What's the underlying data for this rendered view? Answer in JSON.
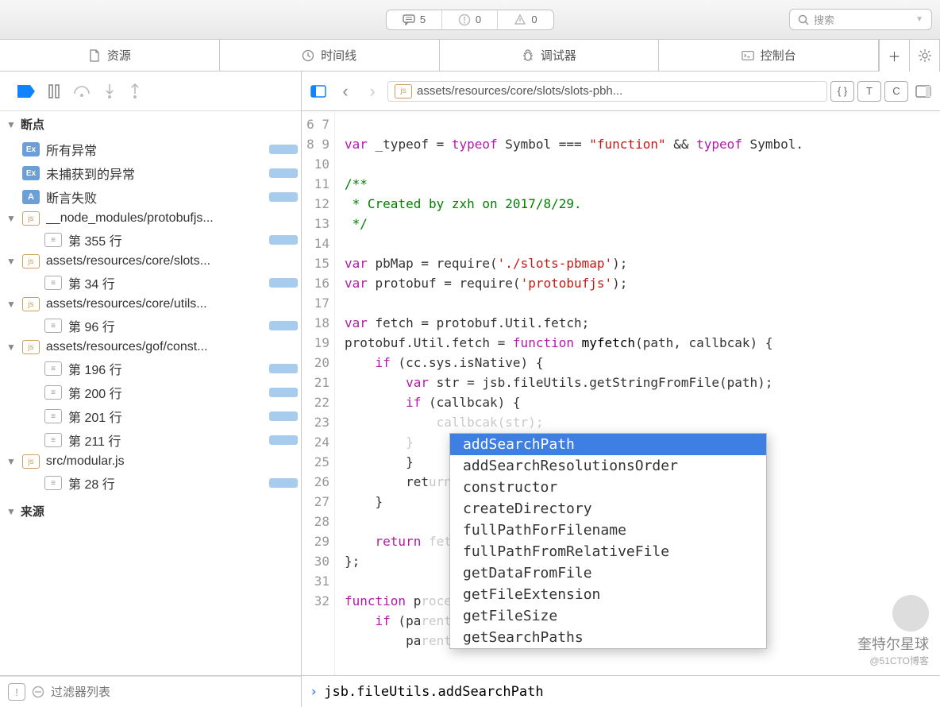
{
  "titlebar": {
    "messages_count": "5",
    "warnings_count": "0",
    "errors_count": "0",
    "search_placeholder": "搜索"
  },
  "panel_tabs": {
    "resources": "资源",
    "timeline": "时间线",
    "debugger": "调试器",
    "console": "控制台"
  },
  "sidebar": {
    "header_breakpoints": "断点",
    "items": [
      {
        "type": "ex",
        "label": "所有异常"
      },
      {
        "type": "ex",
        "label": "未捕获到的异常"
      },
      {
        "type": "a",
        "label": "断言失败"
      }
    ],
    "groups": [
      {
        "badge": "js",
        "label": "__node_modules/protobufjs...",
        "lines": [
          "第 355 行"
        ]
      },
      {
        "badge": "js",
        "label": "assets/resources/core/slots...",
        "lines": [
          "第 34 行"
        ]
      },
      {
        "badge": "js",
        "label": "assets/resources/core/utils...",
        "lines": [
          "第 96 行"
        ]
      },
      {
        "badge": "js",
        "label": "assets/resources/gof/const...",
        "lines": [
          "第 196 行",
          "第 200 行",
          "第 201 行",
          "第 211 行"
        ]
      },
      {
        "badge": "js",
        "label": "src/modular.js",
        "lines": [
          "第 28 行"
        ]
      }
    ],
    "header_sources": "来源",
    "filter_placeholder": "过滤器列表"
  },
  "editor": {
    "breadcrumb": "assets/resources/core/slots/slots-pbh...",
    "first_line_num": 5,
    "code_lines": [
      {
        "n": 6,
        "html": ""
      },
      {
        "n": 7,
        "html": "<span class='kw'>var</span> _typeof = <span class='kw'>typeof</span> Symbol === <span class='str'>\"function\"</span> && <span class='kw'>typeof</span> Symbol."
      },
      {
        "n": 8,
        "html": ""
      },
      {
        "n": 9,
        "html": "<span class='com'>/**</span>"
      },
      {
        "n": 10,
        "html": "<span class='com'> * Created by zxh on 2017/8/29.</span>"
      },
      {
        "n": 11,
        "html": "<span class='com'> */</span>"
      },
      {
        "n": 12,
        "html": ""
      },
      {
        "n": 13,
        "html": "<span class='kw'>var</span> pbMap = require(<span class='str'>'./slots-pbmap'</span>);"
      },
      {
        "n": 14,
        "html": "<span class='kw'>var</span> protobuf = require(<span class='str'>'protobufjs'</span>);"
      },
      {
        "n": 15,
        "html": ""
      },
      {
        "n": 16,
        "html": "<span class='kw'>var</span> fetch = protobuf.Util.fetch;"
      },
      {
        "n": 17,
        "html": "protobuf.Util.fetch = <span class='kw'>function</span> <span class='fn'>myfetch</span>(path, callbcak) {"
      },
      {
        "n": 18,
        "html": "    <span class='kw'>if</span> (cc.sys.isNative) {"
      },
      {
        "n": 19,
        "html": "        <span class='kw'>var</span> str = jsb.fileUtils.getStringFromFile(path);"
      },
      {
        "n": 20,
        "html": "        <span class='kw'>if</span> (callbcak) {"
      },
      {
        "n": 21,
        "html": "            <span class='dim'>callbcak(str);</span>"
      },
      {
        "n": 22,
        "html": "        <span class='dim'>}</span>"
      },
      {
        "n": 23,
        "html": "        }"
      },
      {
        "n": 24,
        "html": "        ret<span class='dim'>urn;</span>"
      },
      {
        "n": 25,
        "html": "    }"
      },
      {
        "n": 26,
        "html": ""
      },
      {
        "n": 27,
        "html": "    <span class='kw'>return</span> <span class='dim'>fetch.call(this, path, callbcak);</span>"
      },
      {
        "n": 28,
        "html": "};"
      },
      {
        "n": 29,
        "html": ""
      },
      {
        "n": 30,
        "html": "<span class='kw'>function</span> p<span class='dim'>rocessNested(parent) {</span>"
      },
      {
        "n": 31,
        "html": "    <span class='kw'>if</span> (pa<span class='dim'>rent['messages']) {</span>"
      },
      {
        "n": 32,
        "html": "        pa<span class='dim'>rent['messages'].forEach(function (child) {</span>"
      }
    ],
    "autocomplete": {
      "selected_index": 0,
      "items": [
        "addSearchPath",
        "addSearchResolutionsOrder",
        "constructor",
        "createDirectory",
        "fullPathForFilename",
        "fullPathFromRelativeFile",
        "getDataFromFile",
        "getFileExtension",
        "getFileSize",
        "getSearchPaths"
      ]
    }
  },
  "console": {
    "expression": "jsb.fileUtils.addSearchPath"
  },
  "watermark": {
    "main": "奎特尔星球",
    "sub": "@51CTO博客"
  }
}
